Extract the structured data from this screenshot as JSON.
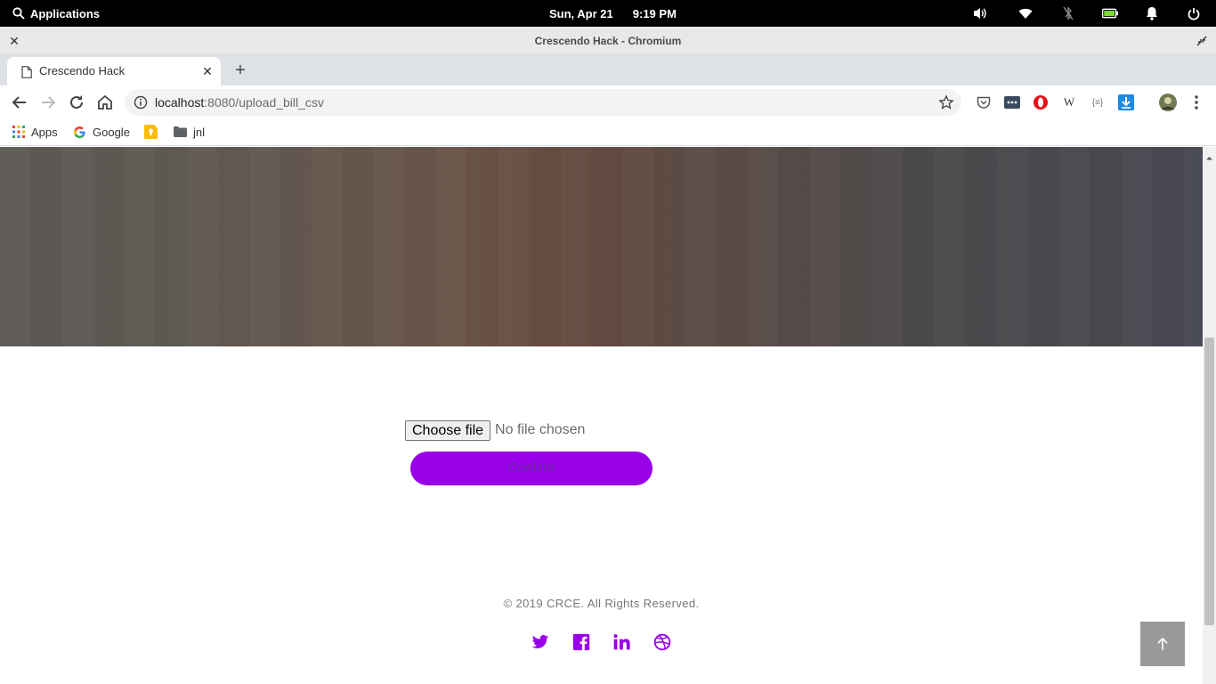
{
  "system_bar": {
    "applications_label": "Applications",
    "date": "Sun, Apr 21",
    "time": "9:19 PM",
    "tray_icons": [
      "volume-icon",
      "wifi-icon",
      "bluetooth-off-icon",
      "battery-icon",
      "notification-bell-icon",
      "power-icon"
    ]
  },
  "window": {
    "title": "Crescendo Hack - Chromium"
  },
  "tabs": [
    {
      "label": "Crescendo Hack",
      "active": true
    }
  ],
  "toolbar": {
    "url_host": "localhost",
    "url_path": ":8080/upload_bill_csv",
    "extensions": [
      "pocket-icon",
      "extension-dots-icon",
      "opera-icon",
      "wikipedia-icon",
      "json-viewer-icon",
      "download-icon",
      "profile-avatar"
    ]
  },
  "bookmarks": [
    {
      "label": "Apps",
      "icon": "apps-grid-icon"
    },
    {
      "label": "Google",
      "icon": "google-icon"
    },
    {
      "label": "",
      "icon": "keep-icon"
    },
    {
      "label": "jnl",
      "icon": "folder-icon"
    }
  ],
  "page": {
    "file_button_label": "Choose file",
    "file_status": "No file chosen",
    "confirm_label": "Confirm",
    "copyright": "© 2019 CRCE. All Rights Reserved.",
    "social_icons": [
      "twitter-icon",
      "facebook-icon",
      "linkedin-icon",
      "dribbble-icon"
    ]
  },
  "colors": {
    "accent": "#9800e8",
    "confirm_text": "#6a2aa0",
    "back_to_top": "#999999"
  }
}
